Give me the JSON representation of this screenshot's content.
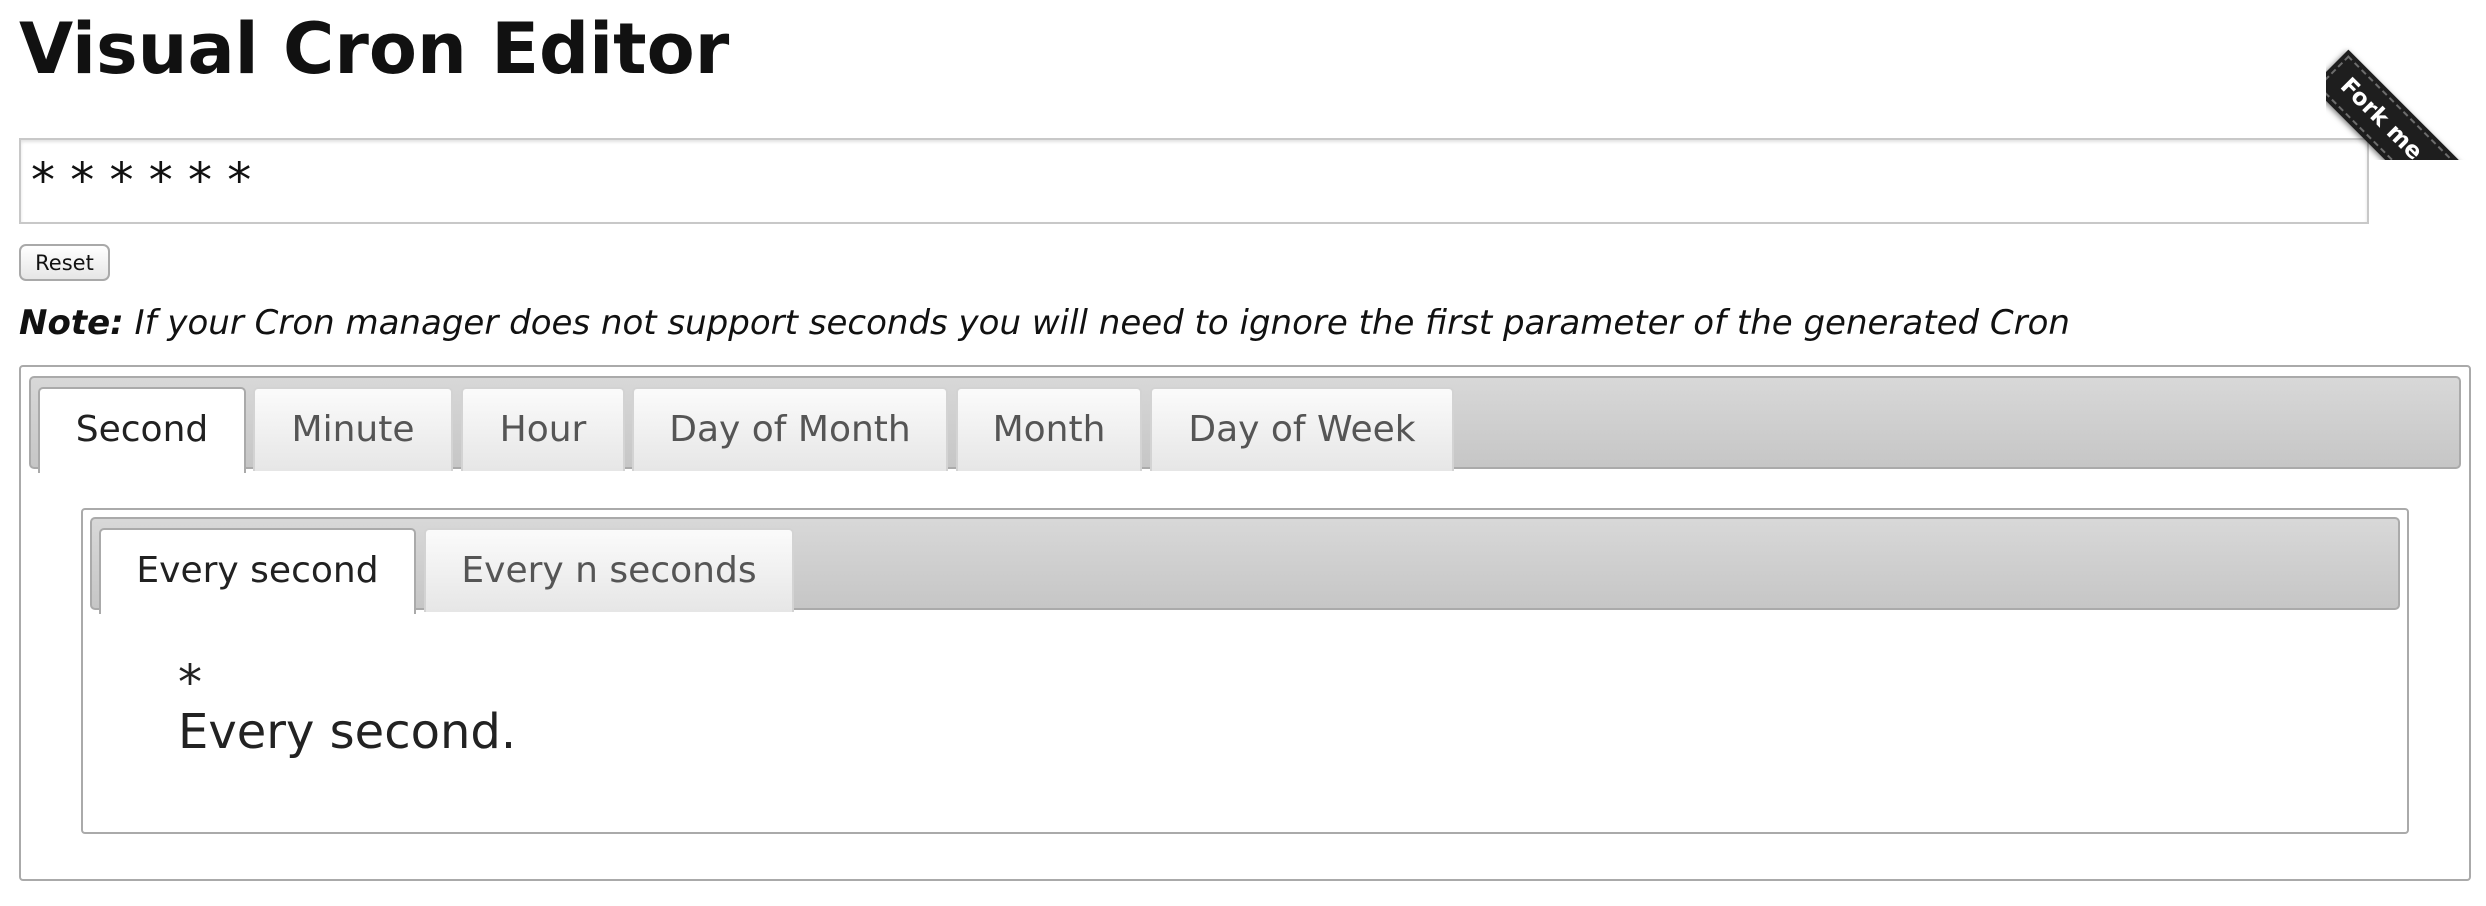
{
  "page": {
    "title": "Visual Cron Editor"
  },
  "cron": {
    "expression": "* * * * * *"
  },
  "reset_label": "Reset",
  "note": {
    "label": "Note:",
    "text": " If your Cron manager does not support seconds you will need to ignore the first parameter of the generated Cron"
  },
  "tabs": [
    {
      "label": "Second",
      "active": true
    },
    {
      "label": "Minute",
      "active": false
    },
    {
      "label": "Hour",
      "active": false
    },
    {
      "label": "Day of Month",
      "active": false
    },
    {
      "label": "Month",
      "active": false
    },
    {
      "label": "Day of Week",
      "active": false
    }
  ],
  "second_tabs": [
    {
      "label": "Every second",
      "active": true
    },
    {
      "label": "Every n seconds",
      "active": false
    }
  ],
  "panel": {
    "symbol": "*",
    "description": "Every second."
  },
  "ribbon": {
    "label": "Fork me on GitHub"
  }
}
